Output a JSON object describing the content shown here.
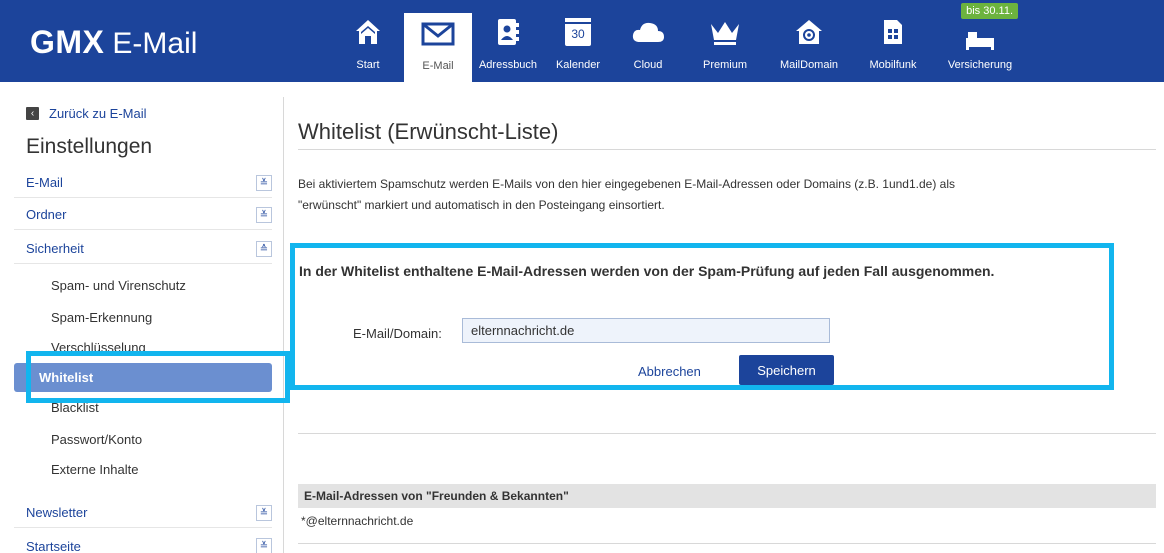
{
  "brand": {
    "name": "GMX",
    "product": "E-Mail"
  },
  "nav": [
    {
      "label": "Start",
      "icon": "home-icon"
    },
    {
      "label": "E-Mail",
      "icon": "mail-icon"
    },
    {
      "label": "Adressbuch",
      "icon": "addressbook-icon"
    },
    {
      "label": "Kalender",
      "icon": "calendar-icon",
      "day": "30"
    },
    {
      "label": "Cloud",
      "icon": "cloud-icon"
    },
    {
      "label": "Premium",
      "icon": "crown-icon"
    },
    {
      "label": "MailDomain",
      "icon": "maildomain-icon"
    },
    {
      "label": "Mobilfunk",
      "icon": "simcard-icon"
    },
    {
      "label": "Versicherung",
      "icon": "bed-icon",
      "badge": "bis 30.11."
    }
  ],
  "sidebar": {
    "back": "Zurück zu E-Mail",
    "title": "Einstellungen",
    "groups": [
      {
        "label": "E-Mail"
      },
      {
        "label": "Ordner"
      },
      {
        "label": "Sicherheit"
      },
      {
        "label": "Newsletter"
      },
      {
        "label": "Startseite"
      }
    ],
    "security_items": [
      "Spam- und Virenschutz",
      "Spam-Erkennung",
      "Verschlüsselung",
      "Whitelist",
      "Blacklist",
      "Passwort/Konto",
      "Externe Inhalte"
    ]
  },
  "main": {
    "title": "Whitelist (Erwünscht-Liste)",
    "description_line1": "Bei aktiviertem Spamschutz werden E-Mails von den hier eingegebenen E-Mail-Adressen oder Domains (z.B. 1und1.de) als",
    "description_line2": "\"erwünscht\" markiert und automatisch in den Posteingang einsortiert.",
    "box_heading": "In der Whitelist enthaltene E-Mail-Adressen werden von der Spam-Prüfung auf jeden Fall ausgenommen.",
    "field_label": "E-Mail/Domain:",
    "field_value": "elternnachricht.de",
    "cancel_label": "Abbrechen",
    "save_label": "Speichern",
    "list_heading": "E-Mail-Adressen von \"Freunden & Bekannten\"",
    "entries": [
      "*@elternnachricht.de"
    ]
  },
  "colors": {
    "brand_blue": "#1c449b",
    "highlight": "#12b5ee",
    "active_item": "#6b8fd0",
    "promo": "#6cb33e"
  }
}
